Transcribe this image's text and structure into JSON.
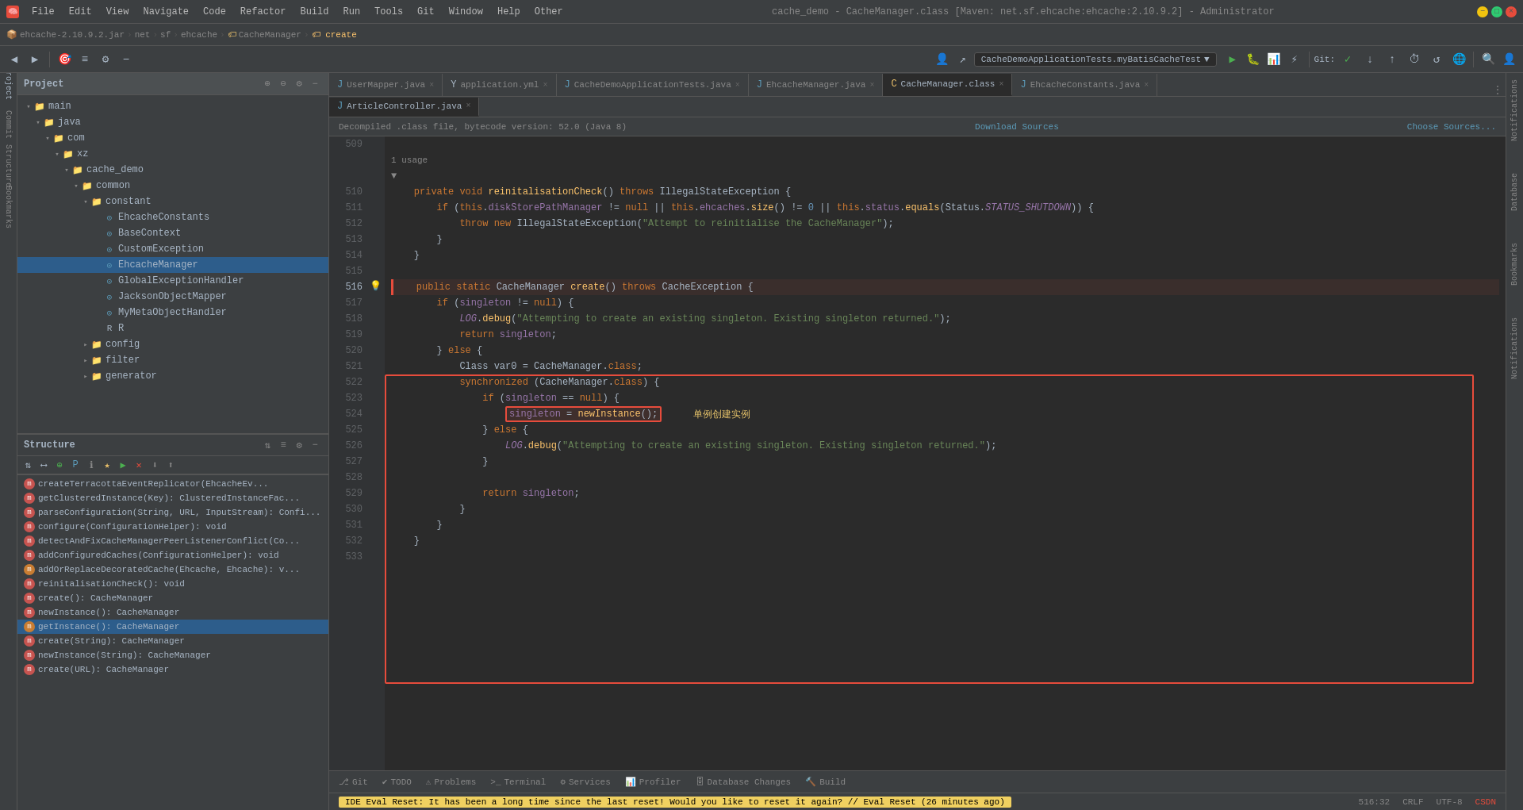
{
  "titleBar": {
    "title": "cache_demo - CacheManager.class [Maven: net.sf.ehcache:ehcache:2.10.9.2] - Administrator",
    "menus": [
      "File",
      "Edit",
      "View",
      "Navigate",
      "Code",
      "Refactor",
      "Build",
      "Run",
      "Tools",
      "Git",
      "Window",
      "Help",
      "Other"
    ]
  },
  "breadcrumb": {
    "items": [
      "ehcache-2.10.9.2.jar",
      "net",
      "sf",
      "ehcache",
      "CacheManager",
      "create"
    ]
  },
  "runConfig": {
    "label": "CacheDemoApplicationTests.myBatisCacheTest"
  },
  "tabs": {
    "row1": [
      {
        "label": "UserMapper.java",
        "icon": "J",
        "active": false
      },
      {
        "label": "application.yml",
        "icon": "Y",
        "active": false
      },
      {
        "label": "CacheDemoApplicationTests.java",
        "icon": "J",
        "active": false
      },
      {
        "label": "EhcacheManager.java",
        "icon": "J",
        "active": false
      },
      {
        "label": "CacheManager.class",
        "icon": "C",
        "active": true
      },
      {
        "label": "EhcacheConstants.java",
        "icon": "J",
        "active": false
      }
    ],
    "row2": [
      {
        "label": "ArticleController.java",
        "icon": "J",
        "active": true
      }
    ]
  },
  "infoBar": {
    "text": "Decompiled .class file, bytecode version: 52.0 (Java 8)",
    "downloadSources": "Download Sources",
    "chooseSources": "Choose Sources..."
  },
  "projectPanel": {
    "title": "Project",
    "tree": [
      {
        "level": 0,
        "type": "folder",
        "label": "main",
        "expanded": true
      },
      {
        "level": 1,
        "type": "folder",
        "label": "java",
        "expanded": true
      },
      {
        "level": 2,
        "type": "folder",
        "label": "com",
        "expanded": true
      },
      {
        "level": 3,
        "type": "folder",
        "label": "xz",
        "expanded": true
      },
      {
        "level": 4,
        "type": "folder",
        "label": "cache_demo",
        "expanded": true
      },
      {
        "level": 5,
        "type": "folder",
        "label": "common",
        "expanded": true
      },
      {
        "level": 6,
        "type": "folder",
        "label": "constant",
        "expanded": true
      },
      {
        "level": 7,
        "type": "file-java",
        "label": "EhcacheConstants"
      },
      {
        "level": 7,
        "type": "file-java",
        "label": "BaseContext"
      },
      {
        "level": 7,
        "type": "file-java",
        "label": "CustomException"
      },
      {
        "level": 7,
        "type": "file-java-selected",
        "label": "EhcacheManager"
      },
      {
        "level": 7,
        "type": "file-java",
        "label": "GlobalExceptionHandler"
      },
      {
        "level": 7,
        "type": "file-java",
        "label": "JacksonObjectMapper"
      },
      {
        "level": 7,
        "type": "file-java",
        "label": "MyMetaObjectHandler"
      },
      {
        "level": 7,
        "type": "file-r",
        "label": "R"
      },
      {
        "level": 6,
        "type": "folder",
        "label": "config",
        "collapsed": true
      },
      {
        "level": 6,
        "type": "folder",
        "label": "filter",
        "collapsed": true
      },
      {
        "level": 6,
        "type": "folder",
        "label": "generator",
        "collapsed": true
      }
    ]
  },
  "structurePanel": {
    "title": "Structure",
    "items": [
      {
        "label": "createTerracottaEventReplicator(EhcacheEv...",
        "color": "red"
      },
      {
        "label": "getClusteredInstance(Key): ClusteredInstanceFac...",
        "color": "red"
      },
      {
        "label": "parseConfiguration(String, URL, InputStream): Confi...",
        "color": "orange"
      },
      {
        "label": "configure(ConfigurationHelper): void",
        "color": "orange"
      },
      {
        "label": "detectAndFixCacheManagerPeerListenerConflict(Co...",
        "color": "red"
      },
      {
        "label": "addConfiguredCaches(ConfigurationHelper): void",
        "color": "red"
      },
      {
        "label": "addOrReplaceDecoratedCache(Ehcache, Ehcache): v...",
        "color": "orange"
      },
      {
        "label": "reinitalisationCheck(): void",
        "color": "red"
      },
      {
        "label": "create(): CacheManager",
        "color": "red"
      },
      {
        "label": "newInstance(): CacheManager",
        "color": "red"
      },
      {
        "label": "getInstance(): CacheManager",
        "color": "orange",
        "selected": true
      },
      {
        "label": "create(String): CacheManager",
        "color": "red"
      },
      {
        "label": "newInstance(String): CacheManager",
        "color": "red"
      },
      {
        "label": "create(URL): CacheManager",
        "color": "red"
      }
    ]
  },
  "codeLines": [
    {
      "num": 509,
      "content": "",
      "indent": 0
    },
    {
      "num": "",
      "content": "1 usage",
      "special": "usage"
    },
    {
      "num": "",
      "content": "▼",
      "special": "arrow"
    },
    {
      "num": 510,
      "content": "    private void reinitalisationCheck() throws IllegalStateException {"
    },
    {
      "num": 511,
      "content": "        if (this.diskStorePathManager != null || this.ehcaches.size() != 0 || this.status.equals(Status.STATUS_SHUTDOWN)) {"
    },
    {
      "num": 512,
      "content": "            throw new IllegalStateException(\"Attempt to reinitialise the CacheManager\");"
    },
    {
      "num": 513,
      "content": "        }"
    },
    {
      "num": 514,
      "content": "    }"
    },
    {
      "num": 515,
      "content": ""
    },
    {
      "num": 516,
      "content": "    public static CacheManager create() throws CacheException {",
      "highlight": true
    },
    {
      "num": 517,
      "content": "        if (singleton != null) {"
    },
    {
      "num": 518,
      "content": "            LOG.debug(\"Attempting to create an existing singleton. Existing singleton returned.\");"
    },
    {
      "num": 519,
      "content": "            return singleton;"
    },
    {
      "num": 520,
      "content": "        } else {"
    },
    {
      "num": 521,
      "content": "            Class var0 = CacheManager.class;"
    },
    {
      "num": 522,
      "content": "            synchronized (CacheManager.class) {"
    },
    {
      "num": 523,
      "content": "                if (singleton == null) {",
      "boxline": true
    },
    {
      "num": 524,
      "content": "                    singleton = newInstance();",
      "inlinebox": true,
      "annotation": "单例创建实例"
    },
    {
      "num": 525,
      "content": "                } else {"
    },
    {
      "num": 526,
      "content": "                    LOG.debug(\"Attempting to create an existing singleton. Existing singleton returned.\");"
    },
    {
      "num": 527,
      "content": "                }"
    },
    {
      "num": 528,
      "content": ""
    },
    {
      "num": 529,
      "content": "                return singleton;"
    },
    {
      "num": 530,
      "content": "            }"
    },
    {
      "num": 531,
      "content": "        }"
    },
    {
      "num": 532,
      "content": "    }"
    },
    {
      "num": 533,
      "content": ""
    }
  ],
  "bottomTabs": [
    {
      "label": "Git",
      "icon": "⎇",
      "active": false
    },
    {
      "label": "TODO",
      "icon": "✔",
      "active": false
    },
    {
      "label": "Problems",
      "icon": "!",
      "active": false
    },
    {
      "label": "Terminal",
      "icon": ">_",
      "active": false
    },
    {
      "label": "Services",
      "icon": "⚙",
      "active": false
    },
    {
      "label": "Profiler",
      "icon": "📊",
      "active": false
    },
    {
      "label": "Database Changes",
      "icon": "🗄",
      "active": false
    },
    {
      "label": "Build",
      "icon": "🔨",
      "active": false
    }
  ],
  "statusBar": {
    "message": "IDE Eval Reset: It has been a long time since the last reset! Would you like to reset it again? // Eval Reset (26 minutes ago)",
    "coords": "516:32",
    "crlf": "CRLF",
    "encoding": "UTF-8"
  },
  "rightPanels": [
    "Notifications",
    "Database",
    "Bookmarks",
    "Notifications"
  ]
}
